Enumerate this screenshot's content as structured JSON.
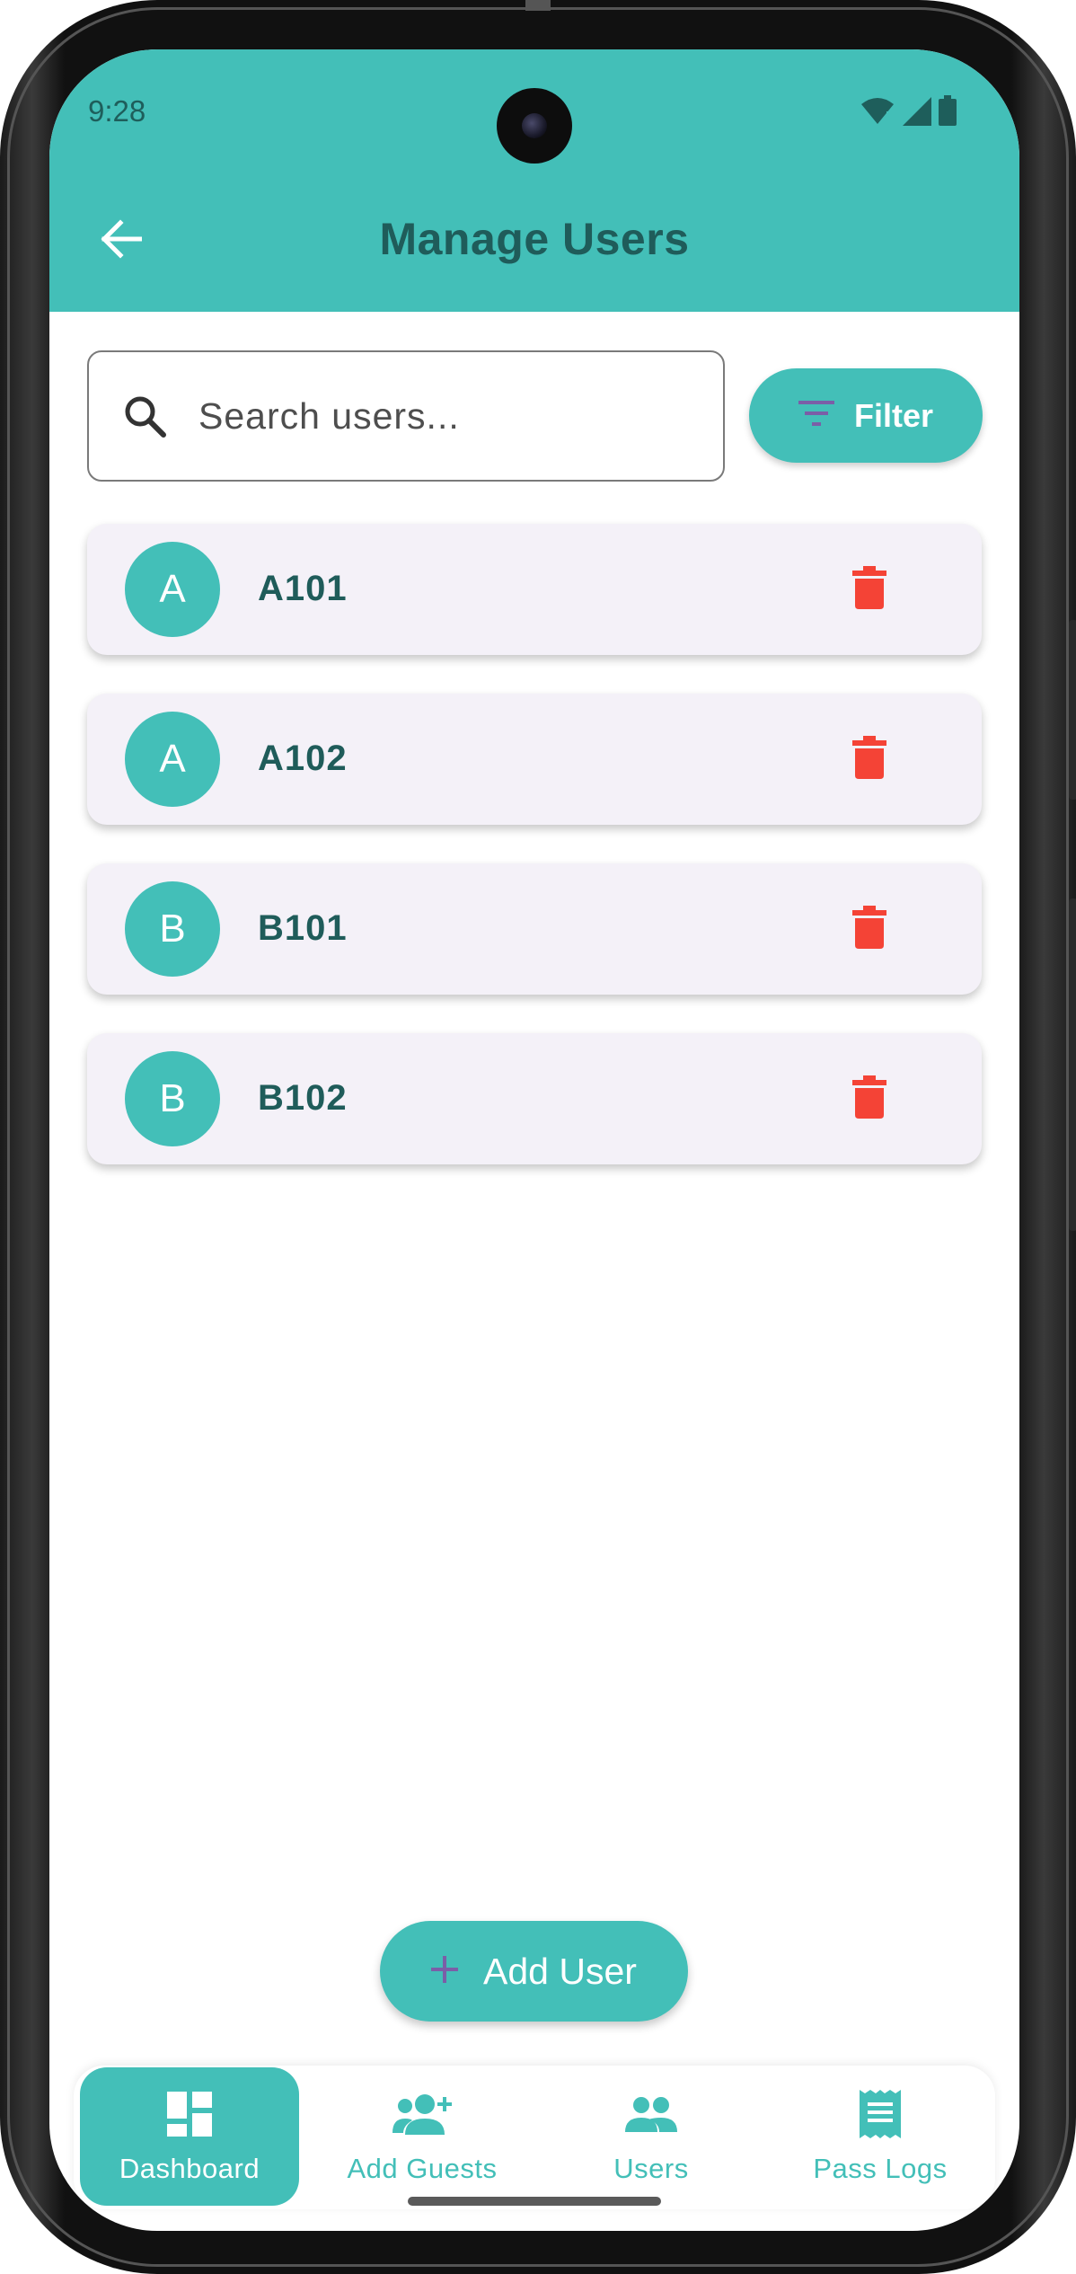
{
  "status_bar": {
    "time": "9:28"
  },
  "header": {
    "title": "Manage Users",
    "back_icon": "arrow-back-icon"
  },
  "search": {
    "placeholder": "Search users...",
    "value": ""
  },
  "filter": {
    "label": "Filter"
  },
  "users": [
    {
      "initial": "A",
      "name": "A101"
    },
    {
      "initial": "A",
      "name": "A102"
    },
    {
      "initial": "B",
      "name": "B101"
    },
    {
      "initial": "B",
      "name": "B102"
    }
  ],
  "fab": {
    "label": "Add User"
  },
  "bottom_nav": {
    "items": [
      {
        "label": "Dashboard",
        "icon": "dashboard-icon",
        "active": true
      },
      {
        "label": "Add Guests",
        "icon": "person-add-icon",
        "active": false
      },
      {
        "label": "Users",
        "icon": "group-icon",
        "active": false
      },
      {
        "label": "Pass Logs",
        "icon": "receipt-icon",
        "active": false
      }
    ]
  },
  "colors": {
    "primary": "#43bfb8",
    "title_text": "#1f5c5a",
    "card_bg": "#f4f1f8",
    "delete": "#f44336",
    "filter_icon": "#7b5ea7"
  }
}
